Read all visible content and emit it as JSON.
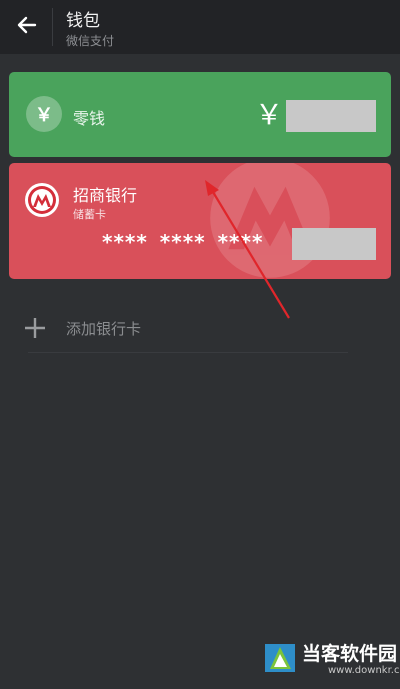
{
  "header": {
    "title": "钱包",
    "subtitle": "微信支付"
  },
  "icons": {
    "back": "arrow-left-icon",
    "coin": "yen-coin-icon",
    "bank_logo": "cmb-logo-icon",
    "add": "plus-icon",
    "annotation": "red-arrow"
  },
  "change_card": {
    "label": "零钱",
    "currency": "￥",
    "coin_symbol": "￥",
    "balance": ""
  },
  "bank_card": {
    "bank_name": "招商银行",
    "card_type": "储蓄卡",
    "card_number_masked": "**** **** ****",
    "last_digits": ""
  },
  "add_card": {
    "label": "添加银行卡"
  },
  "watermark": {
    "name": "当客软件园",
    "url": "www.downkr.com"
  },
  "colors": {
    "background": "#2e3033",
    "topbar": "#222326",
    "change_card": "#4aa35c",
    "bank_card": "#d9505a",
    "annotation": "#e0262b"
  }
}
